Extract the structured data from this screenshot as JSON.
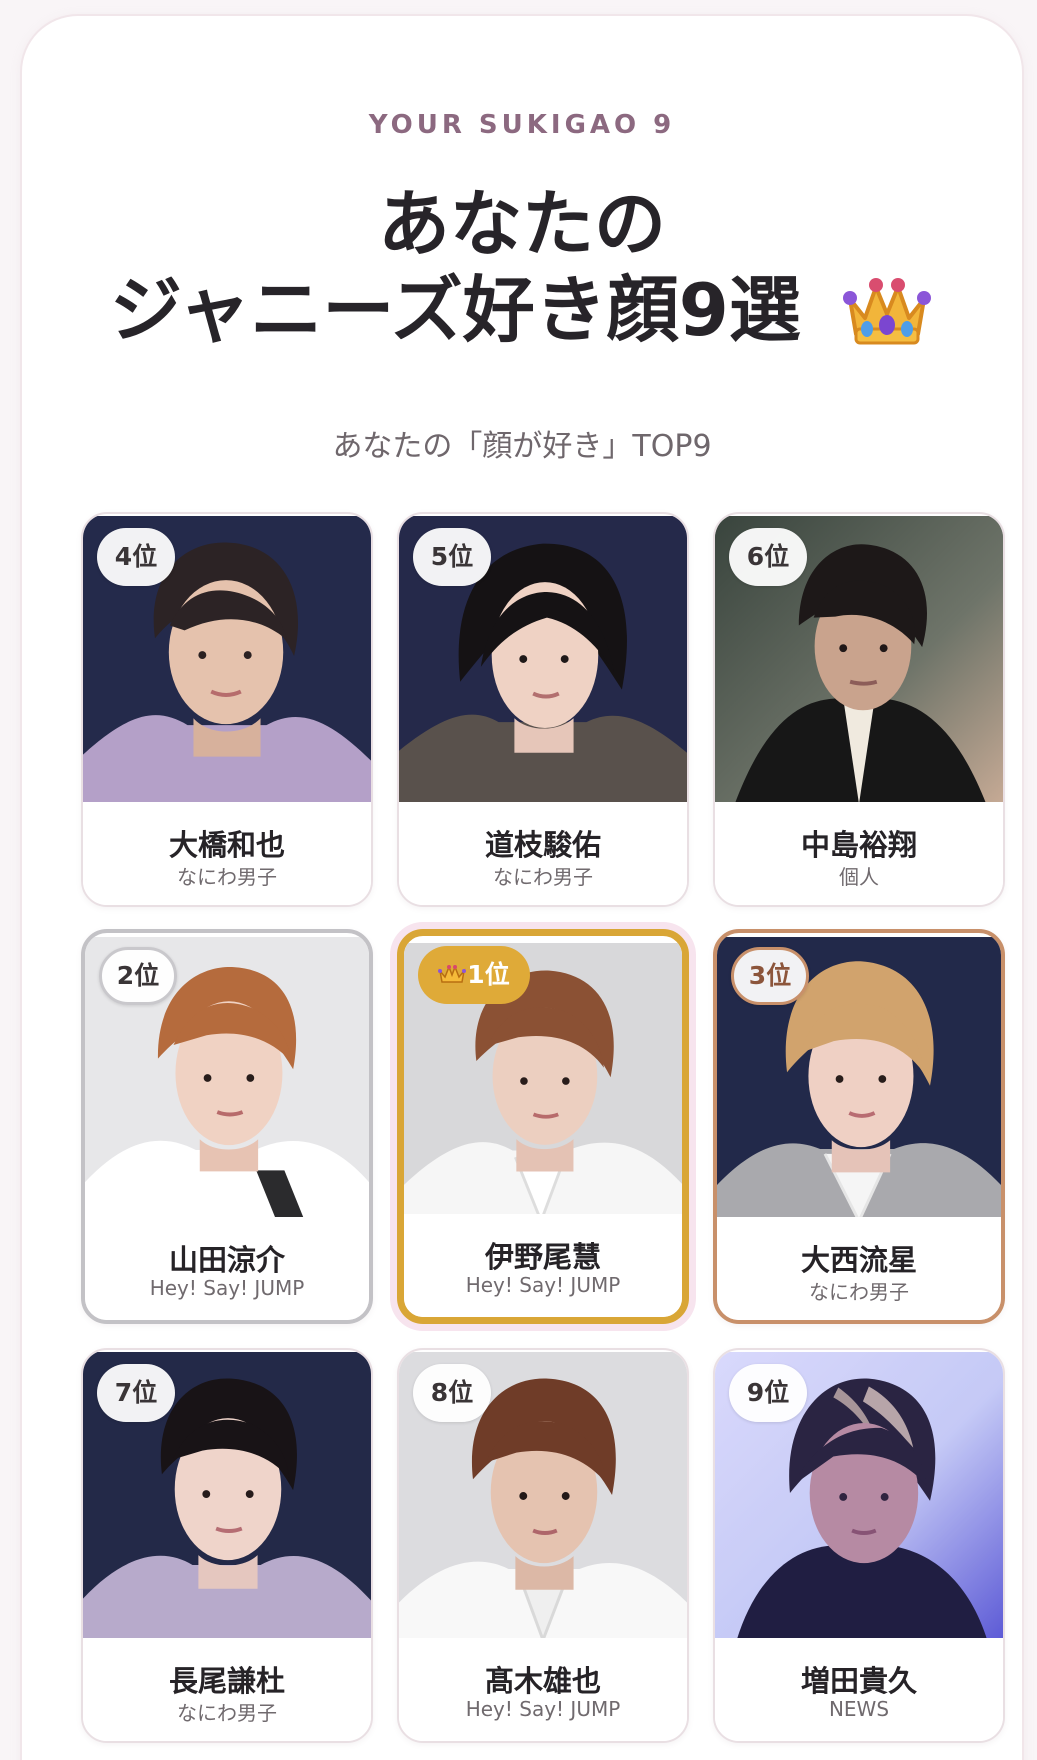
{
  "header": {
    "eyebrow": "YOUR SUKIGAO 9",
    "title_line1": "あなたの",
    "title_line2": "ジャニーズ好き顔9選",
    "title_icon": "crown-icon",
    "subtitle": "あなたの「顔が好き」TOP9"
  },
  "colors": {
    "accent": "#8c6980",
    "gold": "#dfaa38",
    "silver": "#c3c2c6",
    "bronze": "#c8906a",
    "pink_glow": "#f7e4ee"
  },
  "cards": [
    {
      "rank_label": "4位",
      "name": "大橋和也",
      "group": "なにわ男子",
      "image": "portrait-photo"
    },
    {
      "rank_label": "5位",
      "name": "道枝駿佑",
      "group": "なにわ男子",
      "image": "portrait-photo"
    },
    {
      "rank_label": "6位",
      "name": "中島裕翔",
      "group": "個人",
      "image": "portrait-photo"
    },
    {
      "rank_label": "2位",
      "name": "山田涼介",
      "group": "Hey! Say! JUMP",
      "image": "portrait-photo"
    },
    {
      "rank_label": "1位",
      "name": "伊野尾慧",
      "group": "Hey! Say! JUMP",
      "image": "portrait-photo",
      "icon": "crown-icon"
    },
    {
      "rank_label": "3位",
      "name": "大西流星",
      "group": "なにわ男子",
      "image": "portrait-photo"
    },
    {
      "rank_label": "7位",
      "name": "長尾謙杜",
      "group": "なにわ男子",
      "image": "portrait-photo"
    },
    {
      "rank_label": "8位",
      "name": "髙木雄也",
      "group": "Hey! Say! JUMP",
      "image": "portrait-photo"
    },
    {
      "rank_label": "9位",
      "name": "増田貴久",
      "group": "NEWS",
      "image": "portrait-photo"
    }
  ]
}
